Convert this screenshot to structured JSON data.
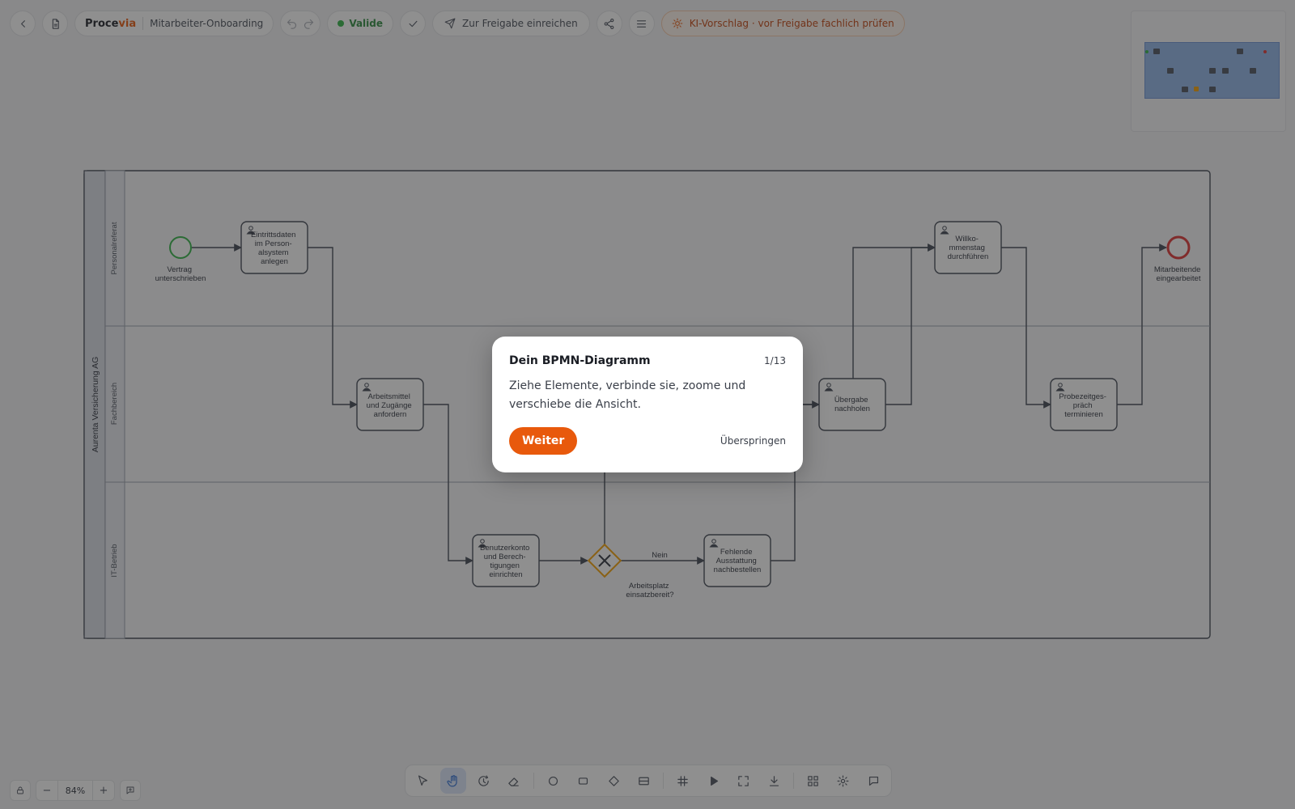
{
  "header": {
    "brand_main": "Proce",
    "brand_accent": "via",
    "document_name": "Mitarbeiter-Onboarding",
    "status_label": "Valide",
    "submit_label": "Zur Freigabe einreichen",
    "ai_notice": "KI-Vorschlag · vor Freigabe fachlich prüfen"
  },
  "diagram": {
    "pool_name": "Aurenta Versicherung AG",
    "lanes": [
      "Personalreferat",
      "Fachbereich",
      "IT-Betrieb"
    ],
    "start_event": [
      "Vertrag",
      "unterschrieben"
    ],
    "end_event": [
      "Mitarbeitende",
      "eingearbeitet"
    ],
    "tasks": {
      "t1": [
        "Eintrittsdaten",
        "im Person-",
        "alsystem",
        "anlegen"
      ],
      "t2": [
        "Arbeitsmittel",
        "und Zugänge",
        "anfordern"
      ],
      "t3": [
        "Benutzerkonto",
        "und Berech-",
        "tigungen",
        "einrichten"
      ],
      "t4": [
        "Fehlende",
        "Ausstattung",
        "nachbestellen"
      ],
      "t5": [
        "Übergabe",
        "nachholen"
      ],
      "t6": [
        "Willko-",
        "mmenstag",
        "durchführen"
      ],
      "t7": [
        "Probezeitges-",
        "präch",
        "terminieren"
      ]
    },
    "gateway_label": [
      "Arbeitsplatz",
      "einsatzbereit?"
    ],
    "flow_no": "Nein"
  },
  "tour": {
    "title": "Dein BPMN-Diagramm",
    "step": "1/13",
    "body": "Ziehe Elemente, verbinde sie, zoome und verschiebe die Ansicht.",
    "next_label": "Weiter",
    "skip_label": "Überspringen"
  },
  "zoom": {
    "level": "84%",
    "minus": "−",
    "plus": "+"
  },
  "colors": {
    "accent": "#e8590c",
    "valid": "#2fb344",
    "start": "#2fb344",
    "end": "#e03131",
    "gateway": "#f59f00"
  }
}
